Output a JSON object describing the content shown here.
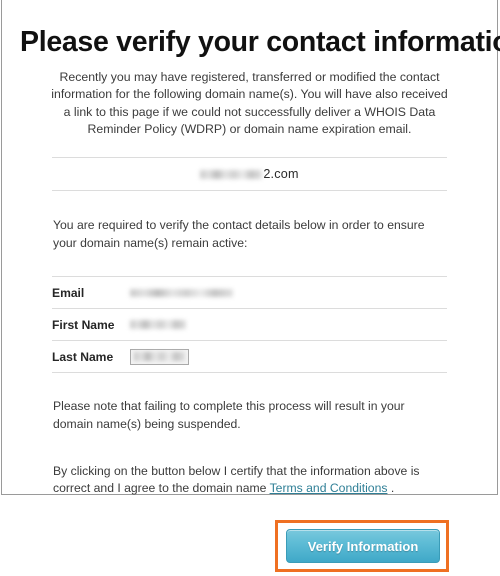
{
  "page": {
    "title": "Please verify your contact information",
    "intro": "Recently you may have registered, transferred or modified the contact information for the following domain name(s). You will have also received a link to this page if we could not successfully deliver a WHOIS Data Reminder Policy (WDRP) or domain name expiration email.",
    "domain_name_suffix": "2.com",
    "domain_name_redacted": true,
    "instructions": "You are required to verify the contact details below in order to ensure your domain name(s) remain active:",
    "note": "Please note that failing to complete this process will result in your domain name(s) being suspended.",
    "certify_prefix": "By clicking on the button below I certify that the information above is correct and I agree to the domain name ",
    "terms_link_label": "Terms and Conditions",
    "certify_suffix": " ."
  },
  "fields": [
    {
      "label": "Email",
      "value": "",
      "redacted": true
    },
    {
      "label": "First Name",
      "value": "",
      "redacted": true
    },
    {
      "label": "Last Name",
      "value": "",
      "redacted": true,
      "boxed": true
    }
  ],
  "actions": {
    "verify_button_label": "Verify Information"
  },
  "colors": {
    "button_top": "#79c8dd",
    "button_bottom": "#3fa8c8",
    "button_border": "#3a9cb8",
    "highlight_border": "#ef7022",
    "link": "#2f7f96",
    "divider": "#dcdcdc",
    "frame_border": "#9a9a9a",
    "text": "#3b3b3b"
  }
}
